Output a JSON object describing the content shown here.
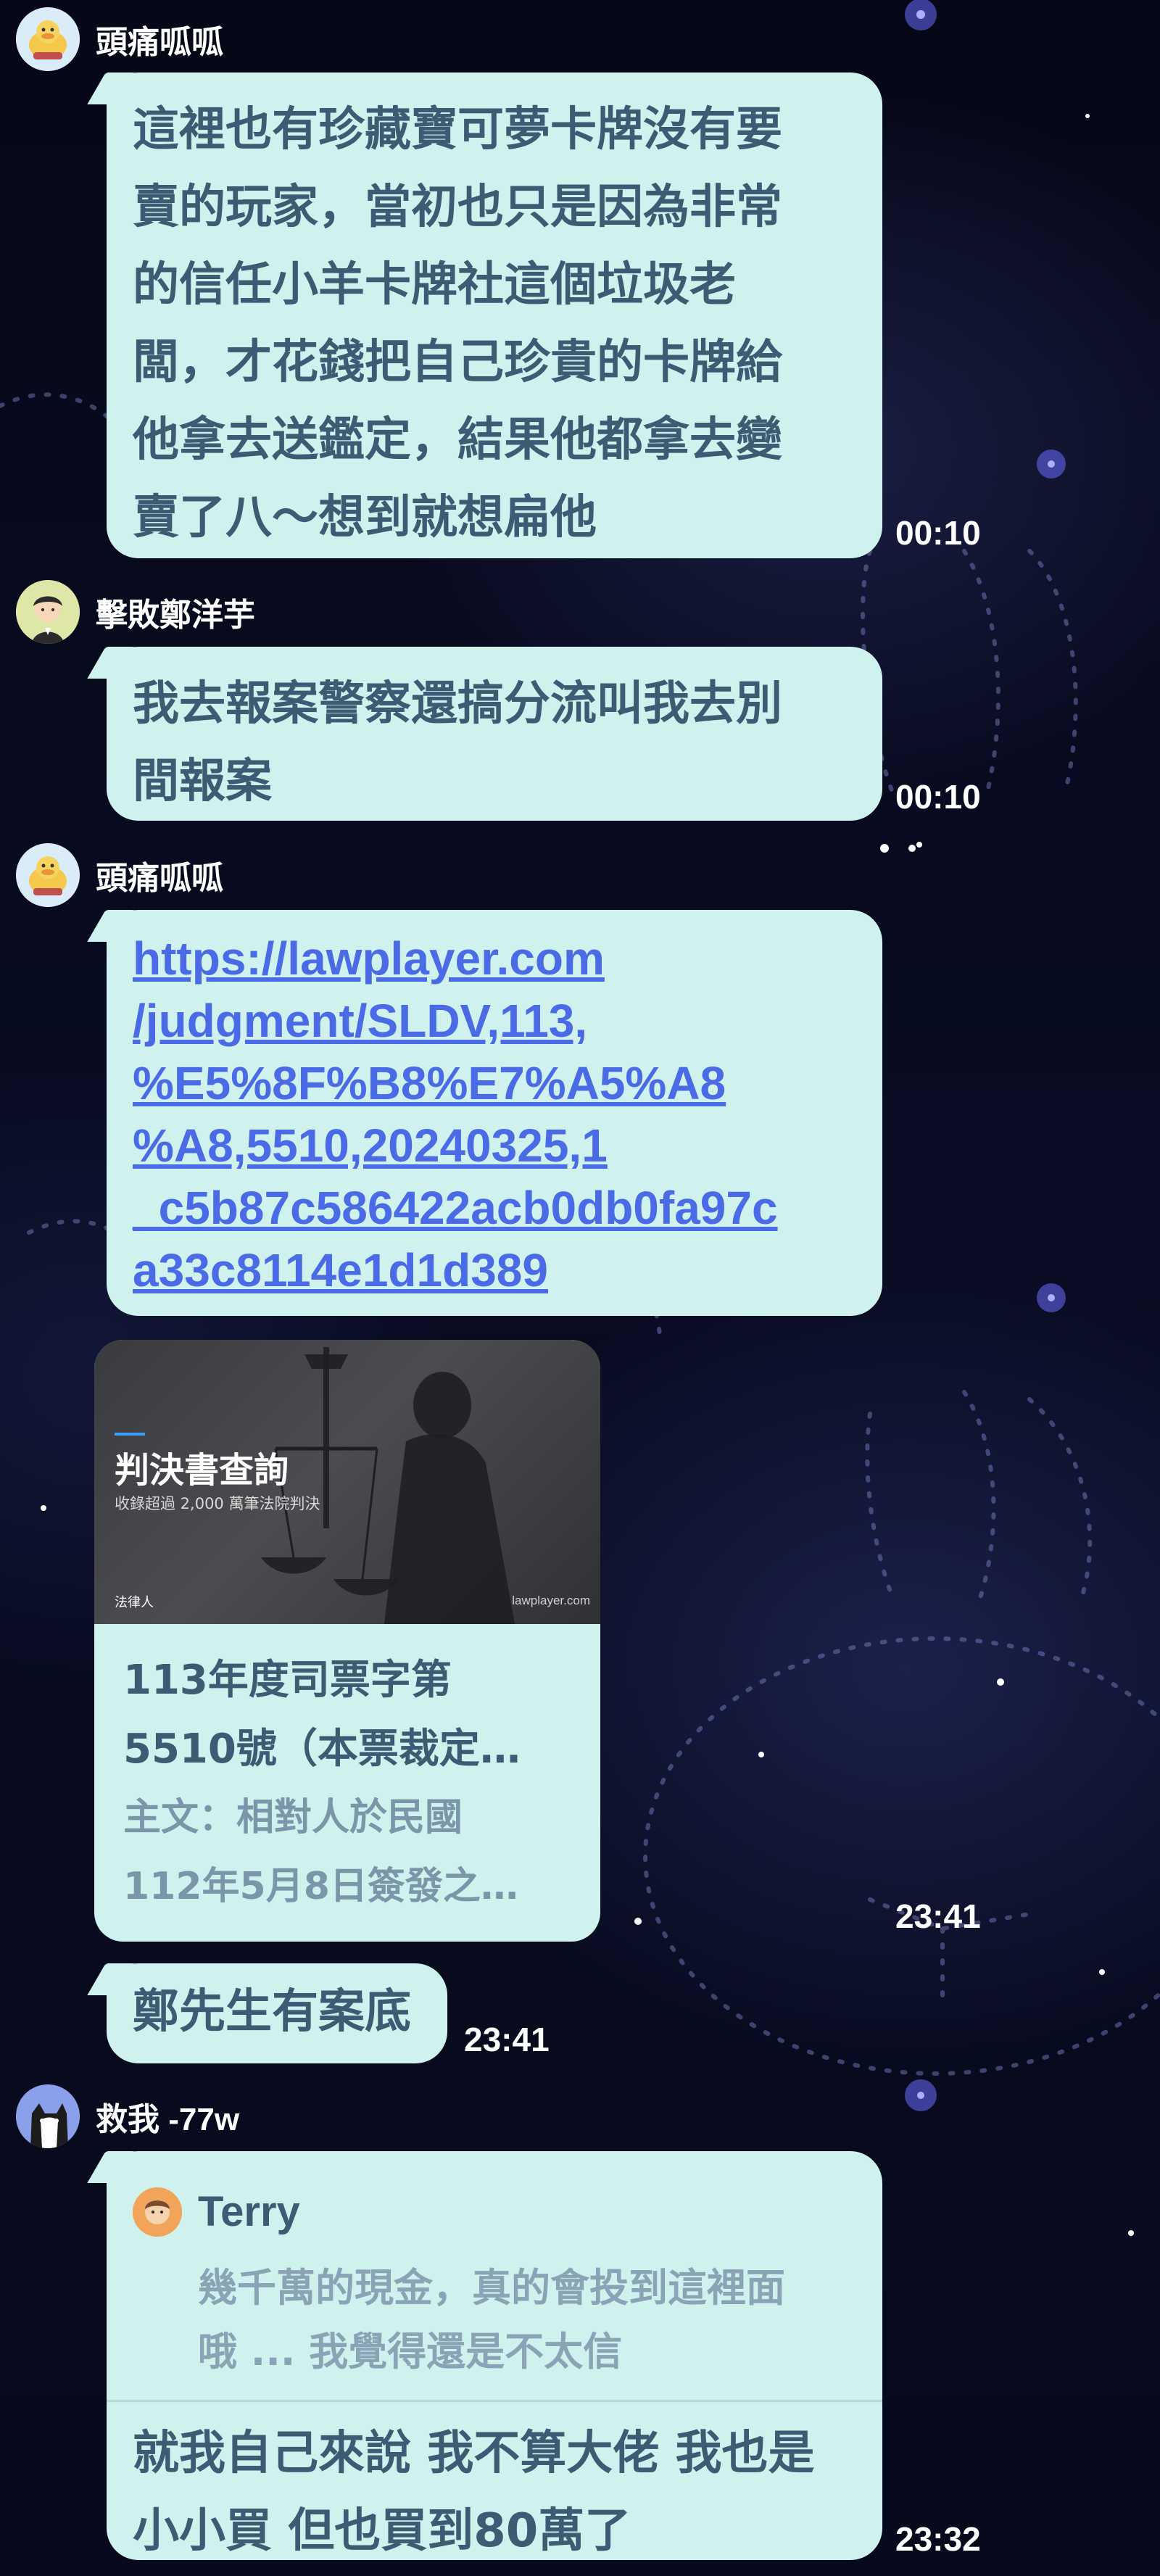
{
  "messages": [
    {
      "sender": "頭痛呱呱",
      "avatar_icon": "duck-avatar",
      "text": "這裡也有珍藏寶可夢卡牌沒有要\n賣的玩家，當初也只是因為非常\n的信任小羊卡牌社這個垃圾老\n闆，才花錢把自己珍貴的卡牌給\n他拿去送鑑定，結果他都拿去變\n賣了八～想到就想扁他",
      "time": "00:10"
    },
    {
      "sender": "擊敗鄭洋芋",
      "avatar_icon": "person-avatar",
      "text": "我去報案警察還搞分流叫我去別\n間報案",
      "time": "00:10"
    },
    {
      "sender": "頭痛呱呱",
      "avatar_icon": "duck-avatar",
      "link": "https://lawplayer.com/judgment/SLDV,113,%E5%8F%B8%E7%A5%A8,5510,20240325,1_c5b87c586422acb0db0fa97ca33c8114e1d1d389",
      "link_lines": [
        "https://lawplayer.com",
        "/judgment/SLDV,113,",
        "%E5%8F%B8%E7%A5%A8",
        "%A8,5510,20240325,1",
        "_c5b87c586422acb0db0fa97c",
        "a33c8114e1d1d389"
      ],
      "card": {
        "image_title": "判決書查詢",
        "image_subtitle": "收錄超過 2,000 萬筆法院判決",
        "logo_text": "法律人",
        "domain": "lawplayer.com",
        "title_lines": [
          "113年度司票字第",
          "5510號（本票裁定…"
        ],
        "desc_lines": [
          "主文：相對人於民國",
          "112年5月8日簽發之…"
        ]
      },
      "card_time": "23:41",
      "short_text": "鄭先生有案底",
      "short_time": "23:41"
    },
    {
      "sender": "救我 -77w",
      "avatar_icon": "cat-avatar",
      "quote": {
        "name": "Terry",
        "avatar_icon": "terry-avatar",
        "text": "幾千萬的現金，真的會投到這裡面\n哦 ... 我覺得還是不太信"
      },
      "text": "就我自己來說 我不算大佬 我也是\n小小買 但也買到80萬了",
      "time": "23:32"
    }
  ]
}
